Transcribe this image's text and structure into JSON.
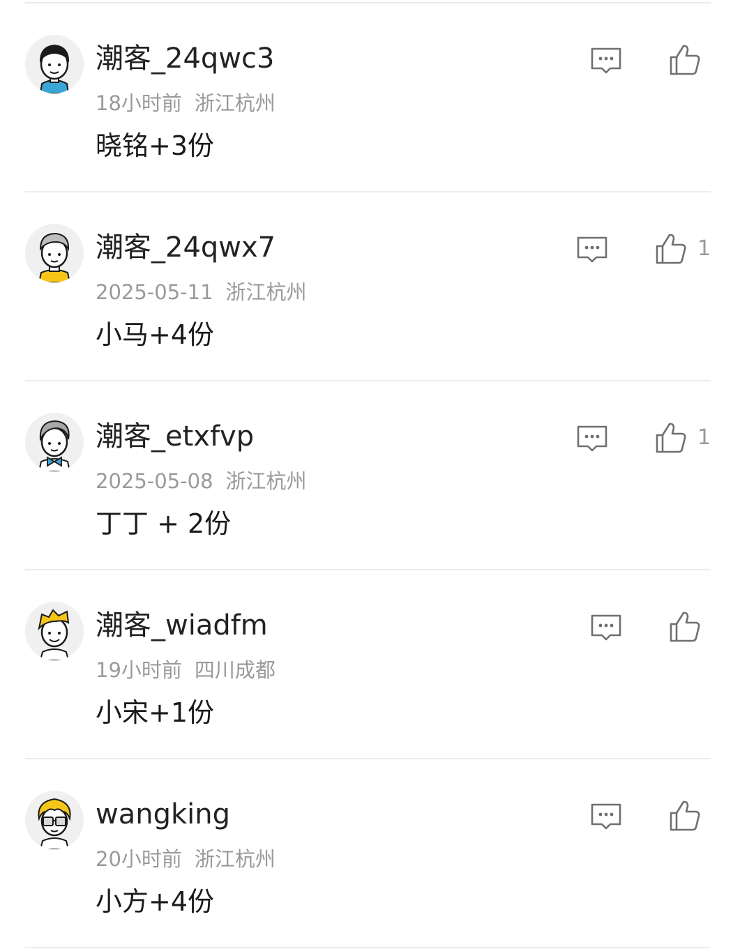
{
  "comments": [
    {
      "username": "潮客_24qwc3",
      "time": "18小时前",
      "location": "浙江杭州",
      "content": "晓铭+3份",
      "likes": "",
      "avatar_icon": "boy-black-hair-avatar-icon",
      "avatar_colors": {
        "hair": "#1a1a1a",
        "shirt": "#3aa6d6"
      }
    },
    {
      "username": "潮客_24qwx7",
      "time": "2025-05-11",
      "location": "浙江杭州",
      "content": "小马+4份",
      "likes": "1",
      "avatar_icon": "man-gray-hair-avatar-icon",
      "avatar_colors": {
        "hair": "#bdbdbd",
        "shirt": "#f5c518"
      }
    },
    {
      "username": "潮客_etxfvp",
      "time": "2025-05-08",
      "location": "浙江杭州",
      "content": "丁丁 + 2份",
      "likes": "1",
      "avatar_icon": "man-gray-hair-bowtie-avatar-icon",
      "avatar_colors": {
        "hair": "#a8a8a8",
        "shirt": "#3aa6d6"
      }
    },
    {
      "username": "潮客_wiadfm",
      "time": "19小时前",
      "location": "四川成都",
      "content": "小宋+1份",
      "likes": "",
      "avatar_icon": "boy-yellow-hair-avatar-icon",
      "avatar_colors": {
        "hair": "#f5c518",
        "shirt": "#ffffff"
      }
    },
    {
      "username": "wangking",
      "time": "20小时前",
      "location": "浙江杭州",
      "content": "小方+4份",
      "likes": "",
      "avatar_icon": "boy-curly-hair-glasses-avatar-icon",
      "avatar_colors": {
        "hair": "#f5c518",
        "shirt": "#ffffff"
      }
    }
  ],
  "icons": {
    "reply": "comment-bubble-icon",
    "like": "thumbs-up-icon"
  },
  "colors": {
    "divider": "#ececec",
    "meta_text": "#9a9a9a",
    "icon_stroke": "#6f6f6f"
  }
}
